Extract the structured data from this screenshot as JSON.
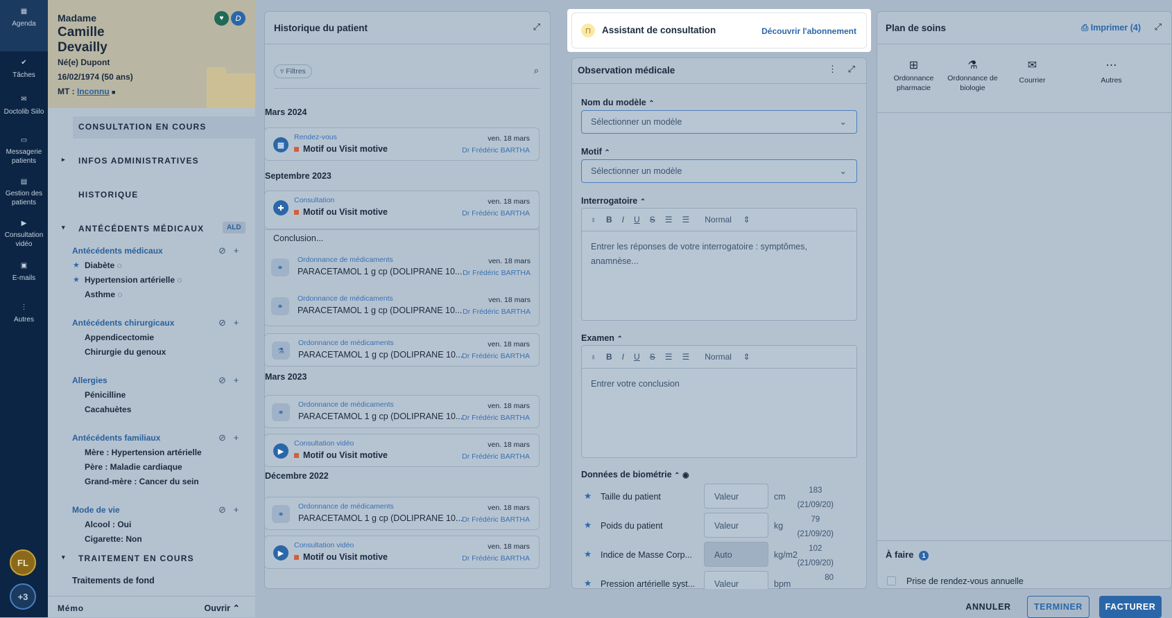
{
  "nav": {
    "items": [
      {
        "label": "Agenda",
        "icon": "calendar-icon"
      },
      {
        "label": "Tâches",
        "icon": "check-icon"
      },
      {
        "label": "Doctolib Siilo",
        "icon": "chat-icon"
      },
      {
        "label": "Messagerie patients",
        "icon": "message-icon"
      },
      {
        "label": "Gestion des patients",
        "icon": "clipboard-icon"
      },
      {
        "label": "Consultation vidéo",
        "icon": "video-icon"
      },
      {
        "label": "E-mails",
        "icon": "inbox-icon"
      },
      {
        "label": "Autres",
        "icon": "more-icon"
      }
    ],
    "user_initials": "FL",
    "more_count": "+3"
  },
  "patient": {
    "civility": "Madame",
    "first_name": "Camille",
    "last_name": "Devailly",
    "birth_name": "Né(e) Dupont",
    "birth": "16/02/1974 (50 ans)",
    "mt_label": "MT :",
    "mt_value": "Inconnu",
    "badge_d": "D"
  },
  "sections": {
    "current": "CONSULTATION EN COURS",
    "admin": "INFOS ADMINISTRATIVES",
    "history": "HISTORIQUE",
    "antecedents": "ANTÉCÉDENTS MÉDICAUX",
    "ald": "ALD",
    "treatment": "TRAITEMENT EN COURS",
    "background_treatments": "Traitements de fond"
  },
  "antecedents": [
    {
      "group": "Antécédents médicaux",
      "items": [
        "Diabète",
        "Hypertension artérielle",
        "Asthme"
      ]
    },
    {
      "group": "Antécédents chirurgicaux",
      "items": [
        "Appendicectomie",
        "Chirurgie du genoux"
      ]
    },
    {
      "group": "Allergies",
      "items": [
        "Pénicilline",
        "Cacahuètes"
      ]
    },
    {
      "group": "Antécédents familiaux",
      "items": [
        "Mère : Hypertension artérielle",
        "Père : Maladie cardiaque",
        "Grand-mère : Cancer du sein"
      ]
    },
    {
      "group": "Mode de vie",
      "items": [
        "Alcool : Oui",
        "Cigarette: Non"
      ]
    }
  ],
  "memo": {
    "label": "Mémo",
    "open": "Ouvrir"
  },
  "history": {
    "title": "Historique du patient",
    "filters": "Filtres",
    "groups": [
      {
        "date": "Mars 2024"
      },
      {
        "date": "Septembre 2023"
      },
      {
        "date": "Mars 2023"
      },
      {
        "date": "Décembre 2022"
      }
    ],
    "events": [
      {
        "type": "Rendez-vous",
        "title": "Motif ou Visit motive",
        "date": "ven. 18 mars",
        "doctor": "Dr Frédéric BARTHA"
      },
      {
        "type": "Consultation",
        "title": "Motif ou Visit motive",
        "date": "ven. 18 mars",
        "doctor": "Dr Frédéric BARTHA"
      },
      {
        "type": "Ordonnance de médicaments",
        "title": "PARACETAMOL 1 g cp (DOLIPRANE 10...",
        "date": "ven. 18 mars",
        "doctor": "Dr Frédéric BARTHA"
      },
      {
        "type": "Ordonnance de médicaments",
        "title": "PARACETAMOL 1 g cp (DOLIPRANE 10...",
        "date": "ven. 18 mars",
        "doctor": "Dr Frédéric BARTHA"
      },
      {
        "type": "Ordonnance de médicaments",
        "title": "PARACETAMOL 1 g cp (DOLIPRANE 10...",
        "date": "ven. 18 mars",
        "doctor": "Dr Frédéric BARTHA"
      },
      {
        "type": "Ordonnance de médicaments",
        "title": "PARACETAMOL 1 g cp (DOLIPRANE 10...",
        "date": "ven. 18 mars",
        "doctor": "Dr Frédéric BARTHA"
      },
      {
        "type": "Consultation vidéo",
        "title": "Motif ou Visit motive",
        "date": "ven. 18 mars",
        "doctor": "Dr Frédéric BARTHA"
      },
      {
        "type": "Ordonnance de médicaments",
        "title": "PARACETAMOL 1 g cp (DOLIPRANE 10...",
        "date": "ven. 18 mars",
        "doctor": "Dr Frédéric BARTHA"
      },
      {
        "type": "Consultation vidéo",
        "title": "Motif ou Visit motive",
        "date": "ven. 18 mars",
        "doctor": "Dr Frédéric BARTHA"
      }
    ],
    "conclusion": "Conclusion..."
  },
  "assistant": {
    "title": "Assistant de consultation",
    "link": "Découvrir l'abonnement"
  },
  "observation": {
    "title": "Observation médicale",
    "model_label": "Nom du modèle",
    "model_placeholder": "Sélectionner un modèle",
    "motif_label": "Motif",
    "motif_placeholder": "Sélectionner un modèle",
    "interro_label": "Interrogatoire",
    "interro_placeholder": "Entrer les réponses de votre interrogatoire : symptômes, anamnèse...",
    "exam_label": "Examen",
    "exam_placeholder": "Entrer votre conclusion",
    "format": "Normal",
    "bio_label": "Données de biométrie",
    "bio": [
      {
        "name": "Taille du patient",
        "value": "Valeur",
        "unit": "cm",
        "prev": "183",
        "prev_date": "(21/09/20)"
      },
      {
        "name": "Poids du patient",
        "value": "Valeur",
        "unit": "kg",
        "prev": "79",
        "prev_date": "(21/09/20)"
      },
      {
        "name": "Indice de Masse Corp...",
        "value": "Auto",
        "unit": "kg/m2",
        "prev": "102",
        "prev_date": "(21/09/20)"
      },
      {
        "name": "Pression artérielle syst...",
        "value": "Valeur",
        "unit": "bpm",
        "prev": "80",
        "prev_date": ""
      }
    ]
  },
  "plan": {
    "title": "Plan de soins",
    "print": "Imprimer (4)",
    "actions": [
      "Ordonnance pharmacie",
      "Ordonnance de biologie",
      "Courrier",
      "Autres"
    ],
    "todo_label": "À faire",
    "todo_count": "1",
    "todo_item": "Prise de rendez-vous annuelle"
  },
  "footer": {
    "cancel": "ANNULER",
    "finish": "TERMINER",
    "bill": "FACTURER"
  }
}
